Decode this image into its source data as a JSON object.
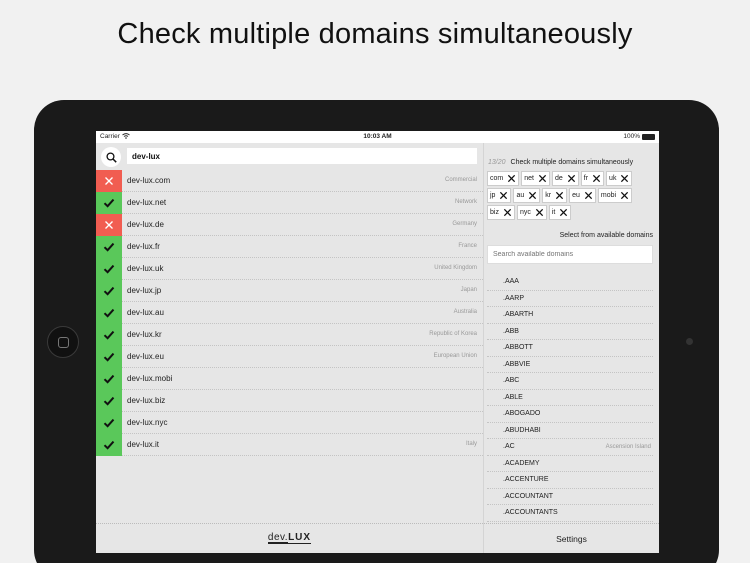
{
  "headline": "Check multiple domains simultaneously",
  "statusbar": {
    "carrier": "Carrier",
    "time": "10:03 AM",
    "battery": "100%"
  },
  "search": {
    "value": "dev-lux"
  },
  "results": [
    {
      "domain": "dev-lux.com",
      "region": "Commercial",
      "status": "taken"
    },
    {
      "domain": "dev-lux.net",
      "region": "Network",
      "status": "ok"
    },
    {
      "domain": "dev-lux.de",
      "region": "Germany",
      "status": "taken"
    },
    {
      "domain": "dev-lux.fr",
      "region": "France",
      "status": "ok"
    },
    {
      "domain": "dev-lux.uk",
      "region": "United Kingdom",
      "status": "ok"
    },
    {
      "domain": "dev-lux.jp",
      "region": "Japan",
      "status": "ok"
    },
    {
      "domain": "dev-lux.au",
      "region": "Australia",
      "status": "ok"
    },
    {
      "domain": "dev-lux.kr",
      "region": "Republic of Korea",
      "status": "ok"
    },
    {
      "domain": "dev-lux.eu",
      "region": "European Union",
      "status": "ok"
    },
    {
      "domain": "dev-lux.mobi",
      "region": "",
      "status": "ok"
    },
    {
      "domain": "dev-lux.biz",
      "region": "",
      "status": "ok"
    },
    {
      "domain": "dev-lux.nyc",
      "region": "",
      "status": "ok"
    },
    {
      "domain": "dev-lux.it",
      "region": "Italy",
      "status": "ok"
    }
  ],
  "logo": {
    "part1": "dev.",
    "part2": "LUX"
  },
  "selection": {
    "count": "13/20",
    "title": "Check multiple domains simultaneously",
    "chips": [
      "com",
      "net",
      "de",
      "fr",
      "uk",
      "jp",
      "au",
      "kr",
      "eu",
      "mobi",
      "biz",
      "nyc",
      "it"
    ]
  },
  "available": {
    "label": "Select from available domains",
    "placeholder": "Search available domains",
    "items": [
      {
        "tld": ".AAA",
        "region": ""
      },
      {
        "tld": ".AARP",
        "region": ""
      },
      {
        "tld": ".ABARTH",
        "region": ""
      },
      {
        "tld": ".ABB",
        "region": ""
      },
      {
        "tld": ".ABBOTT",
        "region": ""
      },
      {
        "tld": ".ABBVIE",
        "region": ""
      },
      {
        "tld": ".ABC",
        "region": ""
      },
      {
        "tld": ".ABLE",
        "region": ""
      },
      {
        "tld": ".ABOGADO",
        "region": ""
      },
      {
        "tld": ".ABUDHABI",
        "region": ""
      },
      {
        "tld": ".AC",
        "region": "Ascension Island"
      },
      {
        "tld": ".ACADEMY",
        "region": ""
      },
      {
        "tld": ".ACCENTURE",
        "region": ""
      },
      {
        "tld": ".ACCOUNTANT",
        "region": ""
      },
      {
        "tld": ".ACCOUNTANTS",
        "region": ""
      }
    ]
  },
  "settings": {
    "label": "Settings"
  },
  "colors": {
    "ok": "#5ac85a",
    "taken": "#f15d51"
  },
  "icons": {
    "ok": "check-icon",
    "taken": "close-icon",
    "search": "search-icon",
    "remove": "close-icon"
  }
}
